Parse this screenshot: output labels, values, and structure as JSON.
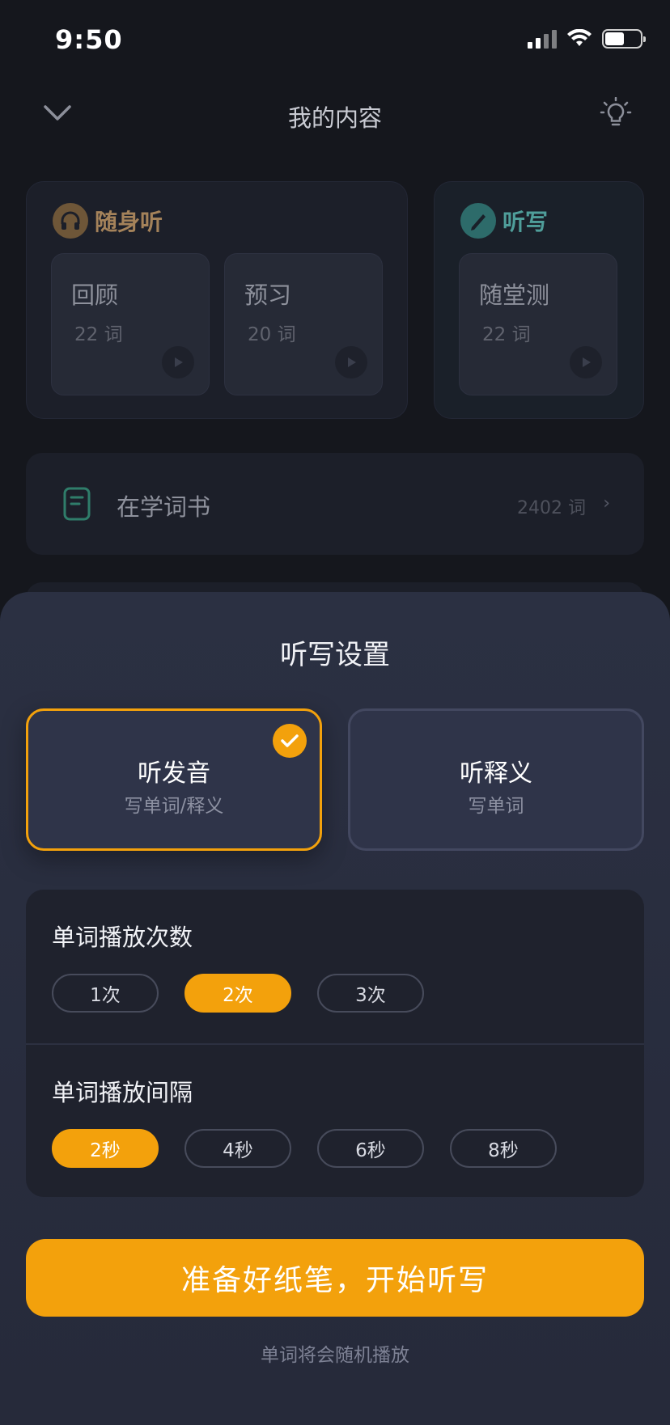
{
  "status_bar": {
    "time": "9:50"
  },
  "header": {
    "title": "我的内容"
  },
  "listen_panel": {
    "name": "随身听",
    "cards": [
      {
        "title": "回顾",
        "count": "22 词"
      },
      {
        "title": "预习",
        "count": "20 词"
      }
    ]
  },
  "dictation_panel": {
    "name": "听写",
    "cards": [
      {
        "title": "随堂测",
        "count": "22 词"
      }
    ]
  },
  "book_row": {
    "label": "在学词书",
    "count": "2402 词"
  },
  "sheet": {
    "title": "听写设置",
    "modes": [
      {
        "title": "听发音",
        "subtitle": "写单词/释义",
        "selected": true
      },
      {
        "title": "听释义",
        "subtitle": "写单词",
        "selected": false
      }
    ],
    "play_times": {
      "label": "单词播放次数",
      "options": [
        "1次",
        "2次",
        "3次"
      ],
      "selected": "2次"
    },
    "play_interval": {
      "label": "单词播放间隔",
      "options": [
        "2秒",
        "4秒",
        "6秒",
        "8秒"
      ],
      "selected": "2秒"
    },
    "start_button": "准备好纸笔，开始听写",
    "hint": "单词将会随机播放"
  },
  "colors": {
    "accent": "#f3a10c",
    "sheet_bg": "#2b3042",
    "page_bg": "#15171d"
  },
  "icons": [
    "chevron-down-icon",
    "lightbulb-icon",
    "headphones-icon",
    "pen-icon",
    "play-icon",
    "book-icon",
    "chevron-right-icon",
    "check-icon",
    "signal-icon",
    "wifi-icon",
    "battery-icon"
  ]
}
